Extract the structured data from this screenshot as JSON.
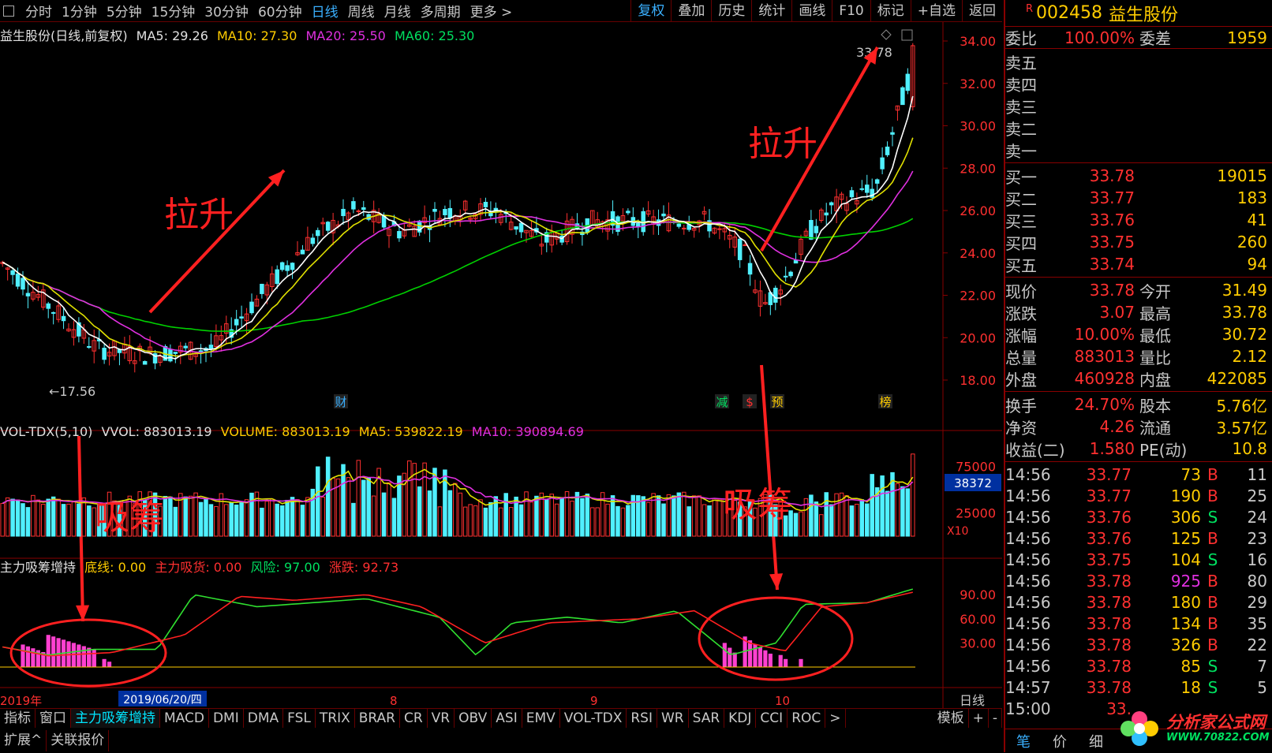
{
  "topbar": {
    "periods": [
      "分时",
      "1分钟",
      "5分钟",
      "15分钟",
      "30分钟",
      "60分钟",
      "日线",
      "周线",
      "月线",
      "多周期",
      "更多 >"
    ],
    "active_period": "日线",
    "tools": [
      "复权",
      "叠加",
      "历史",
      "统计",
      "画线",
      "F10",
      "标记",
      "+自选",
      "返回"
    ],
    "active_tool": "复权"
  },
  "main_chart": {
    "title": "益生股份(日线,前复权)",
    "ma5_label": "MA5: 29.26",
    "ma10_label": "MA10: 27.30",
    "ma20_label": "MA20: 25.50",
    "ma60_label": "MA60: 25.30",
    "y_ticks": [
      "34.00",
      "32.00",
      "30.00",
      "28.00",
      "26.00",
      "24.00",
      "22.00",
      "20.00",
      "18.00"
    ],
    "high_label": "33.78",
    "low_label": "17.56",
    "markers": [
      "财",
      "减",
      "$",
      "预",
      "榜"
    ],
    "annotation_1": "拉升",
    "annotation_2": "拉升"
  },
  "volume_chart": {
    "title": "VOL-TDX(5,10)",
    "vvol_label": "VVOL: 883013.19",
    "volume_label": "VOLUME: 883013.19",
    "ma5_label": "MA5: 539822.19",
    "ma10_label": "MA10: 390894.69",
    "y_ticks": [
      "75000",
      "25000"
    ],
    "current_box": "38372",
    "unit": "X10",
    "annotation_1": "吸筹",
    "annotation_2": "吸筹"
  },
  "indicator_chart": {
    "title": "主力吸筹增持",
    "base_label": "底线: 0.00",
    "absorb_label": "主力吸货: 0.00",
    "risk_label": "风险: 97.00",
    "change_label": "涨跌: 92.73",
    "y_ticks": [
      "90.00",
      "60.00",
      "30.00"
    ]
  },
  "x_axis": {
    "labels": [
      "2019年",
      "2019/06/20/四",
      "8",
      "9",
      "10"
    ],
    "period": "日线"
  },
  "tabbar": {
    "tabs": [
      "指标",
      "窗口",
      "主力吸筹增持",
      "MACD",
      "DMI",
      "DMA",
      "FSL",
      "TRIX",
      "BRAR",
      "CR",
      "VR",
      "OBV",
      "ASI",
      "EMV",
      "VOL-TDX",
      "RSI",
      "WR",
      "SAR",
      "KDJ",
      "CCI",
      "ROC",
      ">"
    ],
    "active": "主力吸筹增持",
    "right": [
      "模板",
      "+",
      "-"
    ]
  },
  "botbar": {
    "items": [
      "扩展^",
      "关联报价"
    ]
  },
  "right_panel": {
    "code": "002458",
    "name": "益生股份",
    "badge": "R",
    "weibi": {
      "label": "委比",
      "value": "100.00%",
      "label2": "委差",
      "value2": "1959"
    },
    "sells": [
      {
        "label": "卖五"
      },
      {
        "label": "卖四"
      },
      {
        "label": "卖三"
      },
      {
        "label": "卖二"
      },
      {
        "label": "卖一"
      }
    ],
    "buys": [
      {
        "label": "买一",
        "price": "33.78",
        "vol": "19015"
      },
      {
        "label": "买二",
        "price": "33.77",
        "vol": "183"
      },
      {
        "label": "买三",
        "price": "33.76",
        "vol": "41"
      },
      {
        "label": "买四",
        "price": "33.75",
        "vol": "260"
      },
      {
        "label": "买五",
        "price": "33.74",
        "vol": "94"
      }
    ],
    "quotes": [
      {
        "l1": "现价",
        "v1": "33.78",
        "l2": "今开",
        "v2": "31.49"
      },
      {
        "l1": "涨跌",
        "v1": "3.07",
        "l2": "最高",
        "v2": "33.78"
      },
      {
        "l1": "涨幅",
        "v1": "10.00%",
        "l2": "最低",
        "v2": "30.72"
      },
      {
        "l1": "总量",
        "v1": "883013",
        "l2": "量比",
        "v2": "2.12"
      },
      {
        "l1": "外盘",
        "v1": "460928",
        "l2": "内盘",
        "v2": "422085"
      }
    ],
    "fund": [
      {
        "l1": "换手",
        "v1": "24.70%",
        "l2": "股本",
        "v2": "5.76亿"
      },
      {
        "l1": "净资",
        "v1": "4.26",
        "l2": "流通",
        "v2": "3.57亿"
      },
      {
        "l1": "收益(二)",
        "v1": "1.580",
        "l2": "PE(动)",
        "v2": "10.8"
      }
    ],
    "ticks": [
      {
        "t": "14:56",
        "p": "33.77",
        "q": "73",
        "bs": "B",
        "n": "11"
      },
      {
        "t": "14:56",
        "p": "33.77",
        "q": "190",
        "bs": "B",
        "n": "25"
      },
      {
        "t": "14:56",
        "p": "33.76",
        "q": "306",
        "bs": "S",
        "n": "24"
      },
      {
        "t": "14:56",
        "p": "33.76",
        "q": "125",
        "bs": "B",
        "n": "23"
      },
      {
        "t": "14:56",
        "p": "33.75",
        "q": "104",
        "bs": "S",
        "n": "16"
      },
      {
        "t": "14:56",
        "p": "33.78",
        "q": "925",
        "bs": "B",
        "n": "80"
      },
      {
        "t": "14:56",
        "p": "33.78",
        "q": "180",
        "bs": "B",
        "n": "29"
      },
      {
        "t": "14:56",
        "p": "33.78",
        "q": "134",
        "bs": "B",
        "n": "35"
      },
      {
        "t": "14:56",
        "p": "33.78",
        "q": "326",
        "bs": "B",
        "n": "22"
      },
      {
        "t": "14:56",
        "p": "33.78",
        "q": "85",
        "bs": "S",
        "n": "7"
      },
      {
        "t": "14:57",
        "p": "33.78",
        "q": "18",
        "bs": "S",
        "n": "5"
      },
      {
        "t": "15:00",
        "p": "33.",
        "q": "",
        "bs": "",
        "n": ""
      }
    ],
    "bottom_tabs": [
      "笔",
      "价",
      "细"
    ],
    "logo_text": "分析家公式网",
    "logo_url": "WWW.70822.COM"
  }
}
